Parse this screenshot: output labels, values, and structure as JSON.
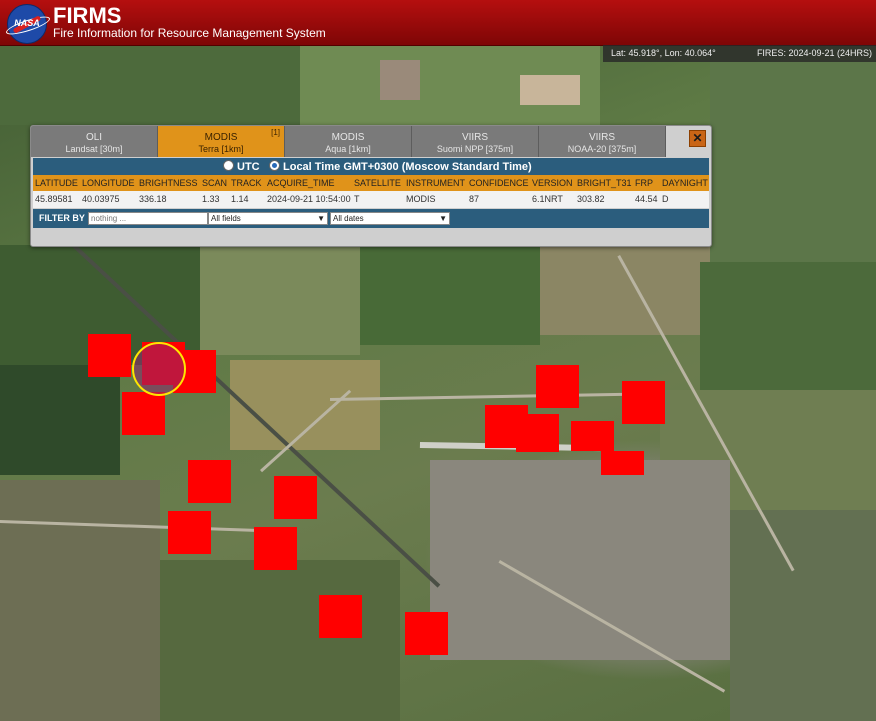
{
  "header": {
    "logo_text": "NASA",
    "title": "FIRMS",
    "subtitle": "Fire Information for Resource Management System"
  },
  "status": {
    "coordinates": "Lat: 45.918°, Lon: 40.064°",
    "fires": "FIRES: 2024-09-21 (24HRS)"
  },
  "popup": {
    "tabs": [
      {
        "name": "OLI",
        "sub": "Landsat [30m]",
        "active": false
      },
      {
        "name": "MODIS",
        "sub": "Terra [1km]",
        "active": true,
        "badge": "[1]"
      },
      {
        "name": "MODIS",
        "sub": "Aqua [1km]",
        "active": false
      },
      {
        "name": "VIIRS",
        "sub": "Suomi NPP [375m]",
        "active": false
      },
      {
        "name": "VIIRS",
        "sub": "NOAA-20 [375m]",
        "active": false
      }
    ],
    "close_icon": "close-x-icon",
    "time_options": {
      "utc": "UTC",
      "local": "Local Time GMT+0300 (Moscow Standard Time)",
      "selected": "local"
    },
    "columns": [
      "LATITUDE",
      "LONGITUDE",
      "BRIGHTNESS",
      "SCAN",
      "TRACK",
      "ACQUIRE_TIME",
      "SATELLITE",
      "INSTRUMENT",
      "CONFIDENCE",
      "VERSION",
      "BRIGHT_T31",
      "FRP",
      "DAYNIGHT"
    ],
    "row": [
      "45.89581",
      "40.03975",
      "336.18",
      "1.33",
      "1.14",
      "2024-09-21 10:54:00",
      "T",
      "MODIS",
      "87",
      "6.1NRT",
      "303.82",
      "44.54",
      "D"
    ],
    "filter": {
      "label": "FILTER BY",
      "placeholder": "nothing ...",
      "field_select": "All fields",
      "date_select": "All dates"
    }
  },
  "colors": {
    "header_red": "#9e0b0b",
    "tab_active": "#e0931a",
    "bar_blue": "#2b5d7d",
    "fire_red": "#ff0000",
    "highlight_ring": "#ffe600"
  },
  "map": {
    "fire_marker_count": 17,
    "selected_fire_highlighted": true
  }
}
